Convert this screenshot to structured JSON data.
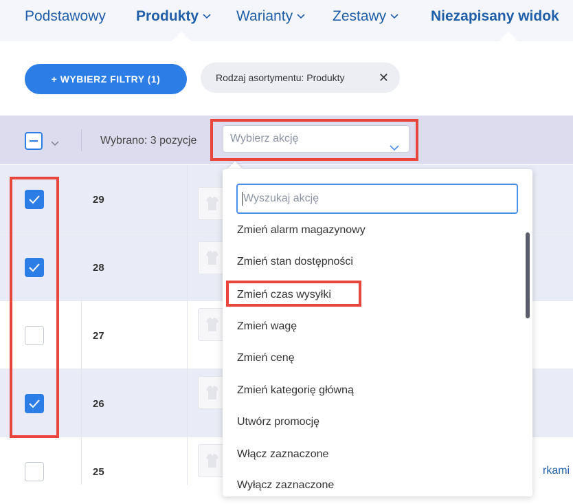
{
  "nav": {
    "items": [
      {
        "label": "Podstawowy",
        "bold": false,
        "dropdown": false
      },
      {
        "label": "Produkty",
        "bold": true,
        "dropdown": true
      },
      {
        "label": "Warianty",
        "bold": false,
        "dropdown": true
      },
      {
        "label": "Zestawy",
        "bold": false,
        "dropdown": true
      },
      {
        "label": "Niezapisany widok",
        "bold": true,
        "dropdown": false
      }
    ]
  },
  "filters": {
    "button_label": "+ WYBIERZ FILTRY (1)",
    "chip_label": "Rodzaj asortymentu: Produkty",
    "chip_close": "✕"
  },
  "selection": {
    "count_label": "Wybrano: 3 pozycje",
    "action_placeholder": "Wybierz akcję"
  },
  "rows": [
    {
      "id": "29",
      "checked": true
    },
    {
      "id": "28",
      "checked": true
    },
    {
      "id": "27",
      "checked": false
    },
    {
      "id": "26",
      "checked": true
    },
    {
      "id": "25",
      "checked": false
    }
  ],
  "row_tail_text": "rkami",
  "dropdown": {
    "search_placeholder": "Wyszukaj akcję",
    "items": [
      "Zmień alarm magazynowy",
      "Zmień stan dostępności",
      "Zmień czas wysyłki",
      "Zmień wagę",
      "Zmień cenę",
      "Zmień kategorię główną",
      "Utwórz promocję",
      "Włącz zaznaczone",
      "Wyłącz zaznaczone"
    ]
  },
  "colors": {
    "accent": "#2c7ee6",
    "nav_text": "#1f5ea8",
    "highlight": "#e8453c",
    "selection_bar": "#dddbee",
    "selected_row": "#e9ebf6"
  }
}
